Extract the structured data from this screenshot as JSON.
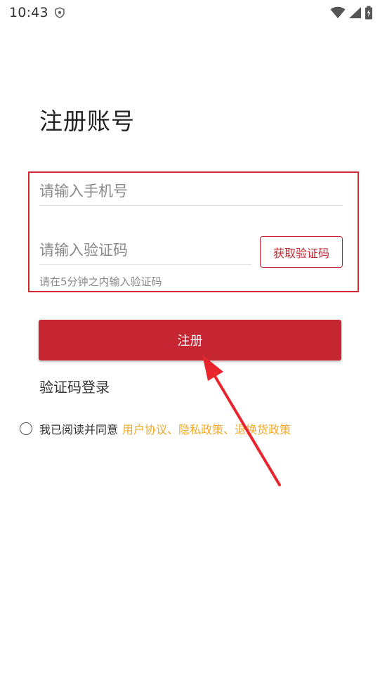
{
  "status_bar": {
    "time": "10:43"
  },
  "page": {
    "title": "注册账号"
  },
  "form": {
    "phone_placeholder": "请输入手机号",
    "phone_value": "",
    "code_placeholder": "请输入验证码",
    "code_value": "",
    "get_code_label": "获取验证码",
    "hint": "请在5分钟之内输入验证码"
  },
  "actions": {
    "register_label": "注册",
    "sms_login_label": "验证码登录"
  },
  "agreement": {
    "checked": false,
    "prefix": "我已阅读并同意",
    "user_agreement": "用户协议、",
    "privacy_policy": "隐私政策、",
    "return_policy": "退换货政策"
  },
  "colors": {
    "brand_red": "#c52632",
    "link_orange": "#f0a92b",
    "annotation_red": "#e8242c"
  }
}
